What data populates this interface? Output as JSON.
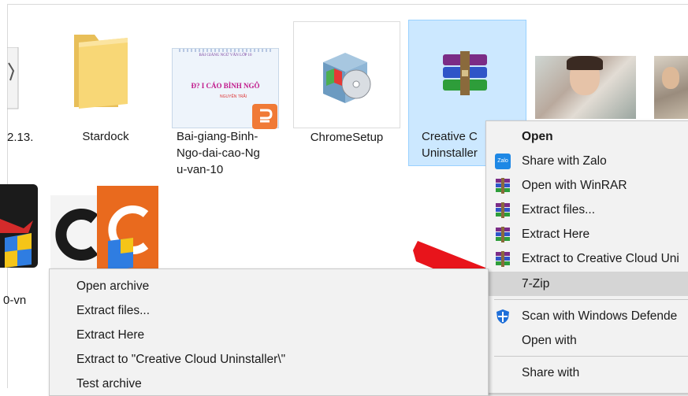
{
  "files": [
    {
      "label": "2.13.",
      "icon": "file-icon"
    },
    {
      "label": "Stardock",
      "icon": "folder-icon"
    },
    {
      "label": "Bai-giang-Binh-Ngo-dai-cao-Ngu-van-10",
      "label_lines": [
        "Bai-giang-Binh-",
        "Ngo-dai-cao-Ng",
        "u-van-10"
      ],
      "icon": "powerpoint-thumbnail"
    },
    {
      "label": "ChromeSetup",
      "icon": "installer-icon"
    },
    {
      "label_lines": [
        "Creative C",
        "Uninstaller"
      ],
      "icon": "winrar-icon",
      "selected": true
    },
    {
      "label": "",
      "icon": "photo-thumbnail"
    },
    {
      "label": "",
      "icon": "photo-thumbnail"
    },
    {
      "label": "0-vn",
      "icon": "app-icon"
    },
    {
      "label": "",
      "icon": "ccleaner-icon"
    }
  ],
  "thumb_text": {
    "title_line": "BÀI GIẢNG NGỮ VĂN LỚP 10",
    "big_title": "Đ? I CÁO BÌNH NGÔ",
    "small_red": "NGUYỄN TRÃI"
  },
  "context_menu": {
    "items": [
      {
        "label": "Open",
        "bold": true,
        "icon": ""
      },
      {
        "label": "Share with Zalo",
        "icon": "zalo-icon"
      },
      {
        "label": "Open with WinRAR",
        "icon": "winrar-icon"
      },
      {
        "label": "Extract files...",
        "icon": "winrar-icon"
      },
      {
        "label": "Extract Here",
        "icon": "winrar-icon"
      },
      {
        "label": "Extract to Creative Cloud Uni",
        "icon": "winrar-icon"
      },
      {
        "label": "7-Zip",
        "icon": "",
        "highlighted": true
      },
      {
        "label": "Scan with Windows Defende",
        "icon": "defender-icon"
      },
      {
        "label": "Open with",
        "icon": ""
      },
      {
        "label": "Share with",
        "icon": ""
      }
    ]
  },
  "submenu_7zip": {
    "items": [
      {
        "label": "Open archive"
      },
      {
        "label": "Extract files..."
      },
      {
        "label": "Extract Here"
      },
      {
        "label": "Extract to \"Creative Cloud Uninstaller\\\""
      },
      {
        "label": "Test archive"
      }
    ]
  },
  "colors": {
    "selection": "#cce8ff",
    "menu_bg": "#f2f2f2",
    "menu_highlight": "#d5d5d5",
    "arrow": "#e8141b"
  }
}
